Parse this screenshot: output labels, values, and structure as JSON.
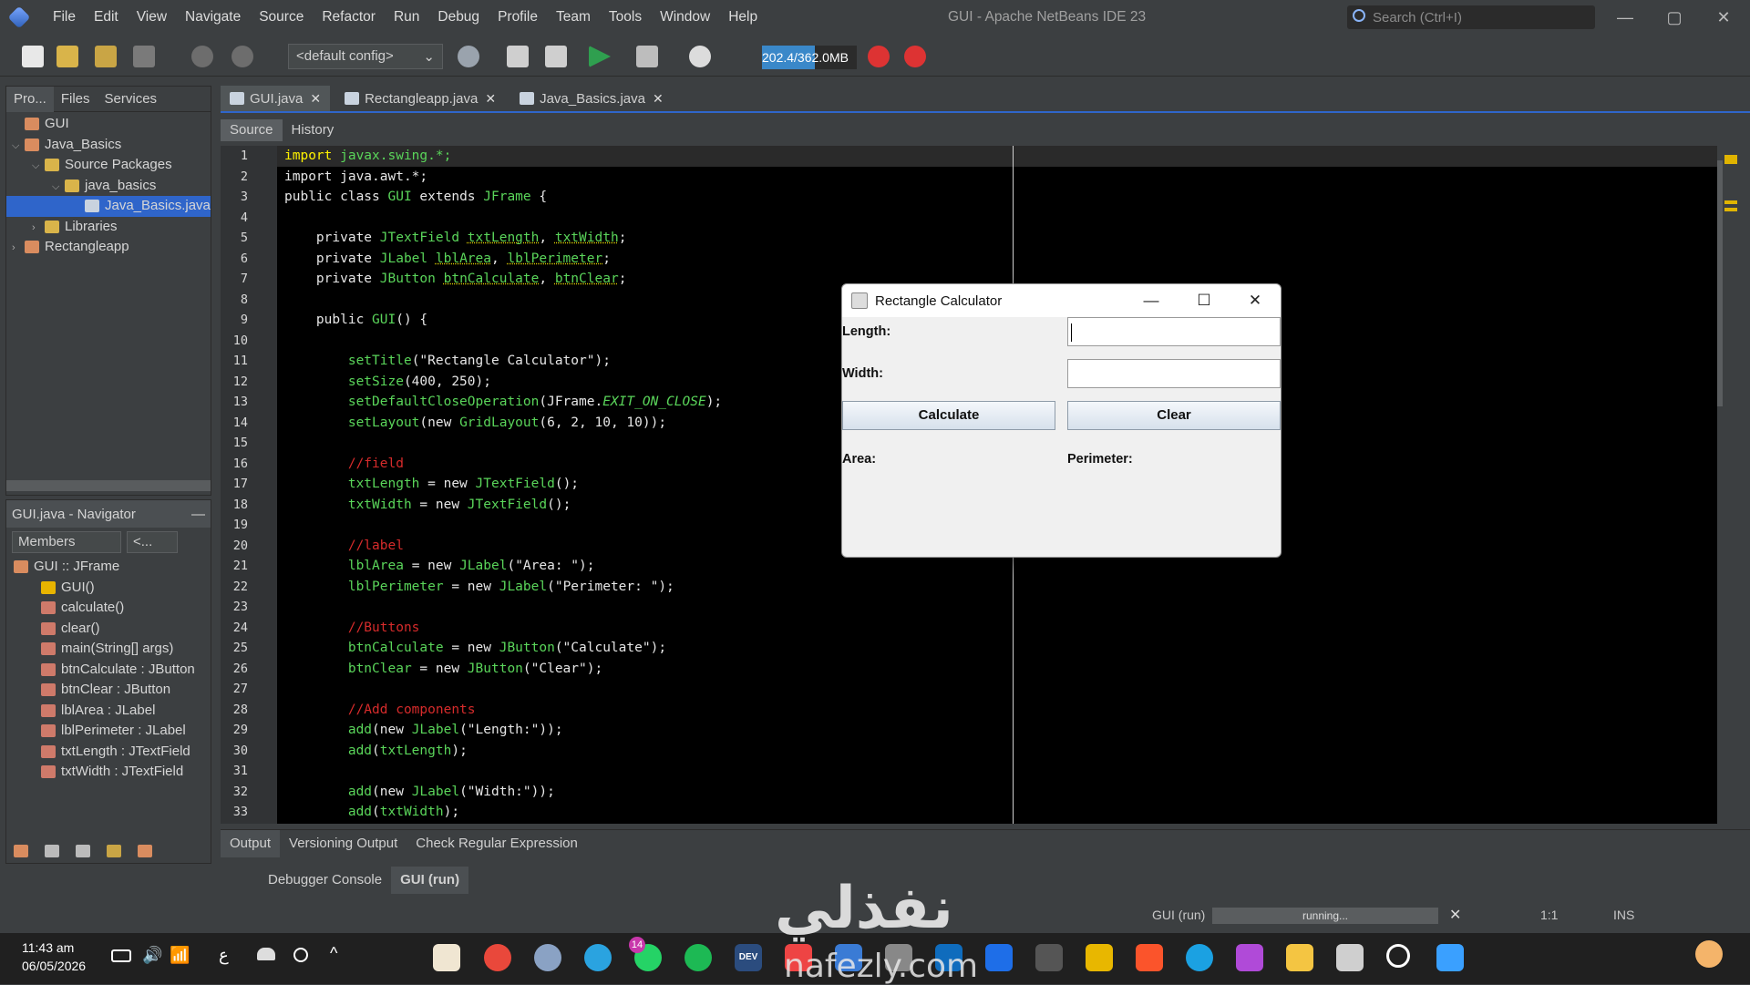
{
  "menu": [
    "File",
    "Edit",
    "View",
    "Navigate",
    "Source",
    "Refactor",
    "Run",
    "Debug",
    "Profile",
    "Team",
    "Tools",
    "Window",
    "Help"
  ],
  "window_title": "GUI - Apache NetBeans IDE 23",
  "search_placeholder": "Search (Ctrl+I)",
  "toolbar": {
    "config": "<default config>",
    "memory": "202.4/362.0MB",
    "memory_used_fraction": 0.56
  },
  "projects_panel": {
    "tabs": [
      "Pro...",
      "Files",
      "Services"
    ],
    "tree": [
      {
        "label": "GUI",
        "depth": 0,
        "arrow": ""
      },
      {
        "label": "Java_Basics",
        "depth": 0,
        "arrow": "v"
      },
      {
        "label": "Source Packages",
        "depth": 1,
        "arrow": "v"
      },
      {
        "label": "java_basics",
        "depth": 2,
        "arrow": "v"
      },
      {
        "label": "Java_Basics.java",
        "depth": 3,
        "arrow": "",
        "selected": true
      },
      {
        "label": "Libraries",
        "depth": 1,
        "arrow": ">"
      },
      {
        "label": "Rectangleapp",
        "depth": 0,
        "arrow": ">"
      }
    ]
  },
  "navigator": {
    "title": "GUI.java - Navigator",
    "filter": "Members",
    "filter2": "<...",
    "items": [
      {
        "label": "GUI :: JFrame",
        "depth": 0
      },
      {
        "label": "GUI()",
        "depth": 1
      },
      {
        "label": "calculate()",
        "depth": 1
      },
      {
        "label": "clear()",
        "depth": 1
      },
      {
        "label": "main(String[] args)",
        "depth": 1
      },
      {
        "label": "btnCalculate : JButton",
        "depth": 1
      },
      {
        "label": "btnClear : JButton",
        "depth": 1
      },
      {
        "label": "lblArea : JLabel",
        "depth": 1
      },
      {
        "label": "lblPerimeter : JLabel",
        "depth": 1
      },
      {
        "label": "txtLength : JTextField",
        "depth": 1
      },
      {
        "label": "txtWidth : JTextField",
        "depth": 1
      }
    ]
  },
  "editor": {
    "tabs": [
      "GUI.java",
      "Rectangleapp.java",
      "Java_Basics.java"
    ],
    "subtabs": [
      "Source",
      "History"
    ],
    "lines": [
      [
        [
          "kwy",
          "import "
        ],
        [
          "tp",
          "javax.swing.*;"
        ]
      ],
      [
        [
          "kw",
          "import java.awt.*;"
        ]
      ],
      [
        [
          "kw",
          "public class "
        ],
        [
          "tp",
          "GUI "
        ],
        [
          "kw",
          "extends "
        ],
        [
          "tp",
          "JFrame "
        ],
        [
          "kw",
          "{"
        ]
      ],
      [
        [
          "kw",
          ""
        ]
      ],
      [
        [
          "kw",
          "    private "
        ],
        [
          "tp",
          "JTextField "
        ],
        [
          "fld",
          "txtLength"
        ],
        [
          "kw",
          ", "
        ],
        [
          "fld",
          "txtWidth"
        ],
        [
          "kw",
          ";"
        ]
      ],
      [
        [
          "kw",
          "    private "
        ],
        [
          "tp",
          "JLabel "
        ],
        [
          "fld",
          "lblArea"
        ],
        [
          "kw",
          ", "
        ],
        [
          "fld",
          "lblPerimeter"
        ],
        [
          "kw",
          ";"
        ]
      ],
      [
        [
          "kw",
          "    private "
        ],
        [
          "tp",
          "JButton "
        ],
        [
          "fld",
          "btnCalculate"
        ],
        [
          "kw",
          ", "
        ],
        [
          "fld",
          "btnClear"
        ],
        [
          "kw",
          ";"
        ]
      ],
      [
        [
          "kw",
          ""
        ]
      ],
      [
        [
          "kw",
          "    public "
        ],
        [
          "tp",
          "GUI"
        ],
        [
          "kw",
          "() {"
        ]
      ],
      [
        [
          "kw",
          ""
        ]
      ],
      [
        [
          "mth",
          "        setTitle"
        ],
        [
          "kw",
          "(\"Rectangle Calculator\");"
        ]
      ],
      [
        [
          "mth",
          "        setSize"
        ],
        [
          "kw",
          "(400, 250);"
        ]
      ],
      [
        [
          "mth",
          "        setDefaultCloseOperation"
        ],
        [
          "kw",
          "(JFrame."
        ],
        [
          "cst",
          "EXIT_ON_CLOSE"
        ],
        [
          "kw",
          ");"
        ]
      ],
      [
        [
          "mth",
          "        setLayout"
        ],
        [
          "kw",
          "(new "
        ],
        [
          "tp",
          "GridLayout"
        ],
        [
          "kw",
          "(6, 2, 10, 10));"
        ]
      ],
      [
        [
          "kw",
          ""
        ]
      ],
      [
        [
          "cmt",
          "        //field"
        ]
      ],
      [
        [
          "tp",
          "        txtLength "
        ],
        [
          "kw",
          "= new "
        ],
        [
          "tp",
          "JTextField"
        ],
        [
          "kw",
          "();"
        ]
      ],
      [
        [
          "tp",
          "        txtWidth "
        ],
        [
          "kw",
          "= new "
        ],
        [
          "tp",
          "JTextField"
        ],
        [
          "kw",
          "();"
        ]
      ],
      [
        [
          "kw",
          ""
        ]
      ],
      [
        [
          "cmt",
          "        //label"
        ]
      ],
      [
        [
          "tp",
          "        lblArea "
        ],
        [
          "kw",
          "= new "
        ],
        [
          "tp",
          "JLabel"
        ],
        [
          "kw",
          "(\"Area: \");"
        ]
      ],
      [
        [
          "tp",
          "        lblPerimeter "
        ],
        [
          "kw",
          "= new "
        ],
        [
          "tp",
          "JLabel"
        ],
        [
          "kw",
          "(\"Perimeter: \");"
        ]
      ],
      [
        [
          "kw",
          ""
        ]
      ],
      [
        [
          "cmt",
          "        //Buttons"
        ]
      ],
      [
        [
          "tp",
          "        btnCalculate "
        ],
        [
          "kw",
          "= new "
        ],
        [
          "tp",
          "JButton"
        ],
        [
          "kw",
          "(\"Calculate\");"
        ]
      ],
      [
        [
          "tp",
          "        btnClear "
        ],
        [
          "kw",
          "= new "
        ],
        [
          "tp",
          "JButton"
        ],
        [
          "kw",
          "(\"Clear\");"
        ]
      ],
      [
        [
          "kw",
          ""
        ]
      ],
      [
        [
          "cmt",
          "        //Add components"
        ]
      ],
      [
        [
          "mth",
          "        add"
        ],
        [
          "kw",
          "(new "
        ],
        [
          "tp",
          "JLabel"
        ],
        [
          "kw",
          "(\"Length:\"));"
        ]
      ],
      [
        [
          "mth",
          "        add"
        ],
        [
          "kw",
          "("
        ],
        [
          "tp",
          "txtLength"
        ],
        [
          "kw",
          ");"
        ]
      ],
      [
        [
          "kw",
          ""
        ]
      ],
      [
        [
          "mth",
          "        add"
        ],
        [
          "kw",
          "(new "
        ],
        [
          "tp",
          "JLabel"
        ],
        [
          "kw",
          "(\"Width:\"));"
        ]
      ],
      [
        [
          "mth",
          "        add"
        ],
        [
          "kw",
          "("
        ],
        [
          "tp",
          "txtWidth"
        ],
        [
          "kw",
          ");"
        ]
      ]
    ]
  },
  "output": {
    "tabs": [
      "Output",
      "Versioning Output",
      "Check Regular Expression"
    ],
    "subtabs": [
      "Debugger Console",
      "GUI (run)"
    ]
  },
  "status": {
    "task": "GUI (run)",
    "progress": "running...",
    "position": "1:1",
    "mode": "INS"
  },
  "app": {
    "title": "Rectangle Calculator",
    "length_label": "Length:",
    "width_label": "Width:",
    "calculate": "Calculate",
    "clear": "Clear",
    "area_label": "Area:",
    "perimeter_label": "Perimeter:"
  },
  "taskbar": {
    "time": "11:43 am",
    "date": "06/05/2026",
    "lang": "ع",
    "whatsapp_badge": "14",
    "dev_label": "DEV"
  },
  "watermark": {
    "arabic": "نفذلي",
    "latin": "nafezly.com"
  },
  "colors": {
    "accent": "#2f65ca",
    "editor_bg": "#000000",
    "ide_bg": "#3c3f41"
  }
}
